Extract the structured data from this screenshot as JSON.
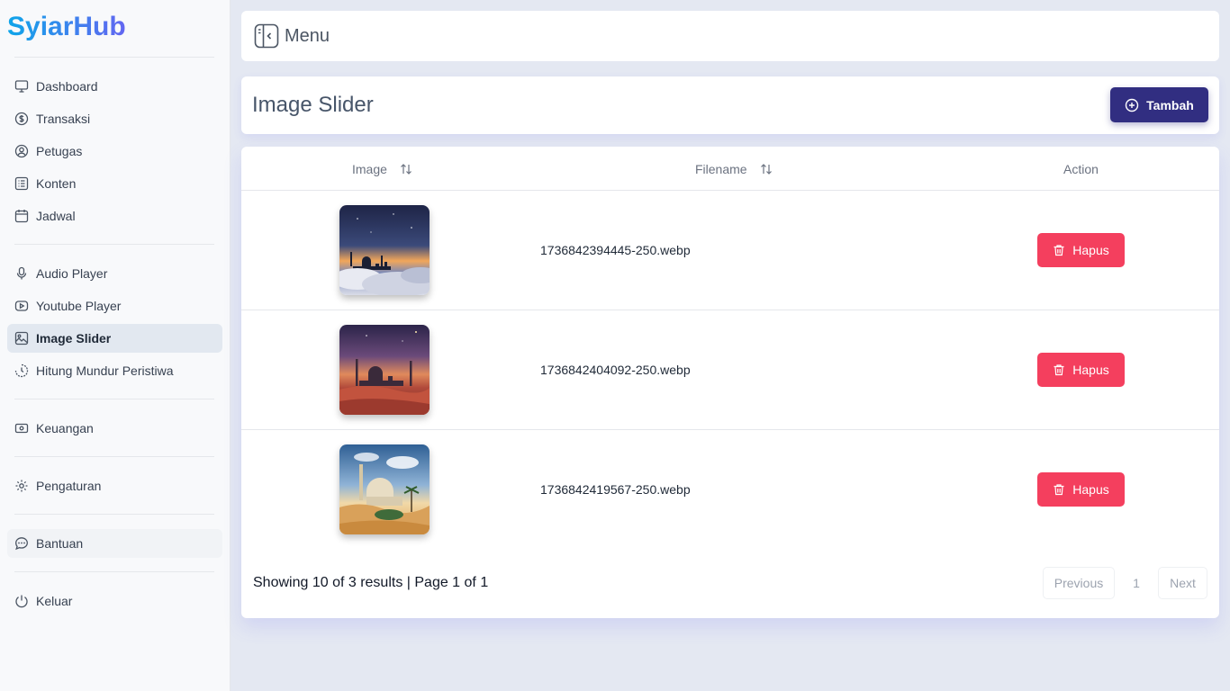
{
  "brand": "SyiarHub",
  "sidebar": {
    "items": [
      {
        "label": "Dashboard",
        "icon": "monitor-icon"
      },
      {
        "label": "Transaksi",
        "icon": "dollar-circle-icon"
      },
      {
        "label": "Petugas",
        "icon": "user-circle-icon"
      },
      {
        "label": "Konten",
        "icon": "list-icon"
      },
      {
        "label": "Jadwal",
        "icon": "calendar-icon"
      },
      {
        "label": "Audio Player",
        "icon": "microphone-icon"
      },
      {
        "label": "Youtube Player",
        "icon": "youtube-icon"
      },
      {
        "label": "Image Slider",
        "icon": "image-icon",
        "active": true
      },
      {
        "label": "Hitung Mundur Peristiwa",
        "icon": "timer-icon"
      },
      {
        "label": "Keuangan",
        "icon": "banknote-icon"
      },
      {
        "label": "Pengaturan",
        "icon": "gear-icon"
      },
      {
        "label": "Bantuan",
        "icon": "chat-icon"
      },
      {
        "label": "Keluar",
        "icon": "power-icon"
      }
    ]
  },
  "topbar": {
    "menu_label": "Menu"
  },
  "page": {
    "title": "Image Slider",
    "add_label": "Tambah"
  },
  "table": {
    "columns": {
      "image": "Image",
      "filename": "Filename",
      "action": "Action"
    },
    "rows": [
      {
        "filename": "1736842394445-250.webp",
        "action_label": "Hapus"
      },
      {
        "filename": "1736842404092-250.webp",
        "action_label": "Hapus"
      },
      {
        "filename": "1736842419567-250.webp",
        "action_label": "Hapus"
      }
    ]
  },
  "pagination": {
    "summary": "Showing 10 of 3 results | Page 1 of 1",
    "previous": "Previous",
    "page": "1",
    "next": "Next"
  },
  "colors": {
    "primary": "#312e81",
    "danger": "#f43f5e",
    "active_nav": "#e2e8f0"
  }
}
